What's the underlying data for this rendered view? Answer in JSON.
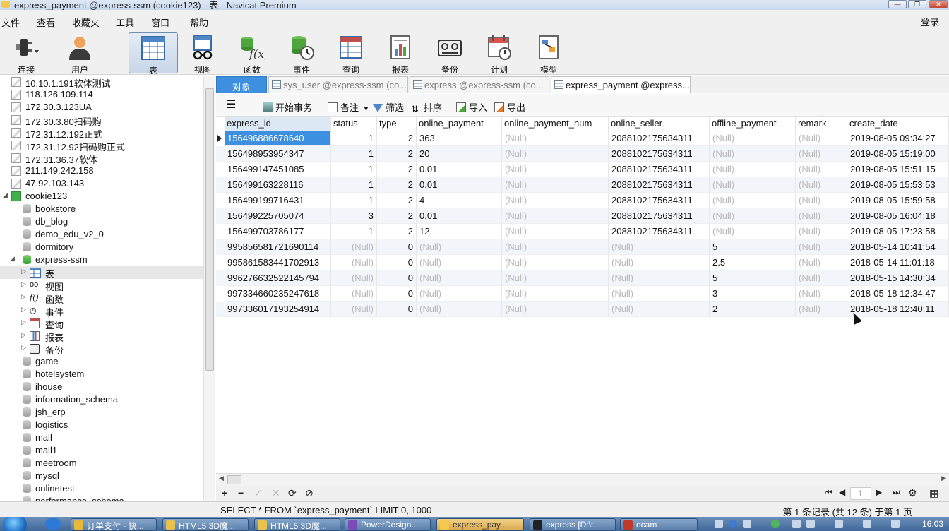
{
  "window": {
    "title": "express_payment @express-ssm (cookie123) - 表 - Navicat Premium",
    "controls": [
      "—",
      "❐",
      "✕"
    ]
  },
  "menu": {
    "items": [
      "文件",
      "查看",
      "收藏夹",
      "工具",
      "窗口",
      "帮助"
    ],
    "login": "登录"
  },
  "toolbar": {
    "buttons": [
      {
        "label": "连接",
        "icon": "plug-icon"
      },
      {
        "label": "用户",
        "icon": "user-icon"
      },
      {
        "label": "表",
        "icon": "table-icon",
        "active": true
      },
      {
        "label": "视图",
        "icon": "view-icon"
      },
      {
        "label": "函数",
        "icon": "function-icon"
      },
      {
        "label": "事件",
        "icon": "event-icon"
      },
      {
        "label": "查询",
        "icon": "query-icon"
      },
      {
        "label": "报表",
        "icon": "report-icon"
      },
      {
        "label": "备份",
        "icon": "backup-icon"
      },
      {
        "label": "计划",
        "icon": "schedule-icon"
      },
      {
        "label": "模型",
        "icon": "model-icon"
      }
    ]
  },
  "sidebar": {
    "connections": [
      "10.10.1.191软体测试",
      "118.126.109.114",
      "172.30.3.123UA",
      "172.30.3.80扫码购",
      "172.31.12.192正式",
      "172.31.12.92扫码购正式",
      "172.31.36.37软体",
      "211.149.242.158",
      "47.92.103.143",
      "cookie123"
    ],
    "databases_top": [
      "bookstore",
      "db_blog",
      "demo_edu_v2_0",
      "dormitory",
      "express-ssm"
    ],
    "express_children": [
      "表",
      "视图",
      "函数",
      "事件",
      "查询",
      "报表",
      "备份"
    ],
    "databases_bottom": [
      "game",
      "hotelsystem",
      "ihouse",
      "information_schema",
      "jsh_erp",
      "logistics",
      "mall",
      "mall1",
      "meetroom",
      "mysql",
      "onlinetest",
      "performance_schema"
    ]
  },
  "tabs": [
    {
      "label": "对象",
      "kind": "object"
    },
    {
      "label": "sys_user @express-ssm (co...",
      "kind": "table"
    },
    {
      "label": "express @express-ssm (co...",
      "kind": "table"
    },
    {
      "label": "express_payment @express...",
      "kind": "table",
      "active": true
    }
  ],
  "subtoolbar": {
    "begin_tx": "开始事务",
    "note": "备注",
    "filter": "筛选",
    "sort": "排序",
    "import": "导入",
    "export": "导出"
  },
  "grid": {
    "columns": [
      "express_id",
      "status",
      "type",
      "online_payment",
      "online_payment_num",
      "online_seller",
      "offline_payment",
      "remark",
      "create_date"
    ],
    "null_text": "(Null)",
    "rows": [
      [
        "156496886678640",
        "1",
        "2",
        "363",
        null,
        "2088102175634311",
        null,
        null,
        "2019-08-05 09:34:27"
      ],
      [
        "156498953954347",
        "1",
        "2",
        "20",
        null,
        "2088102175634311",
        null,
        null,
        "2019-08-05 15:19:00"
      ],
      [
        "156499147451085",
        "1",
        "2",
        "0.01",
        null,
        "2088102175634311",
        null,
        null,
        "2019-08-05 15:51:15"
      ],
      [
        "156499163228116",
        "1",
        "2",
        "0.01",
        null,
        "2088102175634311",
        null,
        null,
        "2019-08-05 15:53:53"
      ],
      [
        "156499199716431",
        "1",
        "2",
        "4",
        null,
        "2088102175634311",
        null,
        null,
        "2019-08-05 15:59:58"
      ],
      [
        "156499225705074",
        "3",
        "2",
        "0.01",
        null,
        "2088102175634311",
        null,
        null,
        "2019-08-05 16:04:18"
      ],
      [
        "156499703786177",
        "1",
        "2",
        "12",
        null,
        "2088102175634311",
        null,
        null,
        "2019-08-05 17:23:58"
      ],
      [
        "995856581721690114",
        null,
        "0",
        null,
        null,
        null,
        "5",
        null,
        "2018-05-14 10:41:54"
      ],
      [
        "995861583441702913",
        null,
        "0",
        null,
        null,
        null,
        "2.5",
        null,
        "2018-05-14 11:01:18"
      ],
      [
        "996276632522145794",
        null,
        "0",
        null,
        null,
        null,
        "5",
        null,
        "2018-05-15 14:30:34"
      ],
      [
        "997334660235247618",
        null,
        "0",
        null,
        null,
        null,
        "3",
        null,
        "2018-05-18 12:34:47"
      ],
      [
        "997336017193254914",
        null,
        "0",
        null,
        null,
        null,
        "2",
        null,
        "2018-05-18 12:40:11"
      ]
    ]
  },
  "navbar": {
    "page": "1",
    "left_buttons": [
      "+",
      "−",
      "✓",
      "✕",
      "⟳",
      "⊘"
    ],
    "right_buttons": [
      "⏮",
      "◀",
      "▶",
      "⏭",
      "⚙",
      "▦"
    ]
  },
  "status": {
    "sql": "SELECT * FROM `express_payment` LIMIT 0, 1000",
    "records": "第 1 条记录 (共 12 条) 于第 1 页"
  },
  "taskbar": {
    "items": [
      {
        "label": "订单支付 - 快...",
        "color": "#e8b83a"
      },
      {
        "label": "HTML5 3D魔...",
        "color": "#e8c24a"
      },
      {
        "label": "HTML5 3D魔...",
        "color": "#e8c24a"
      },
      {
        "label": "PowerDesign...",
        "color": "#7b4bb8"
      },
      {
        "label": "express_pay...",
        "color": "#f2c94c",
        "active": true
      },
      {
        "label": "express [D:\\t...",
        "color": "#222222"
      },
      {
        "label": "ocam",
        "color": "#c0392b"
      }
    ],
    "clock": "16:03"
  },
  "colors": {
    "accent": "#3d8fe0",
    "null_gray": "#b8b8b8",
    "alt_row": "#f2f6fb"
  }
}
